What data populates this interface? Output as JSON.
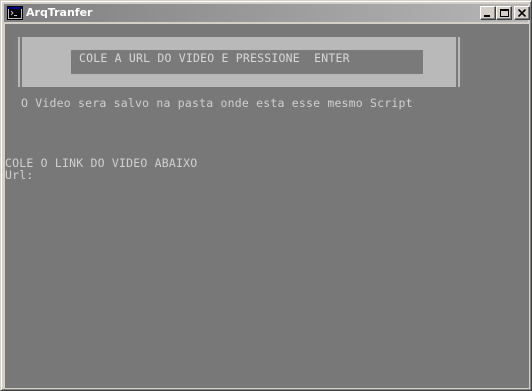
{
  "window": {
    "title": "ArqTranfer",
    "icon": "console-app-icon",
    "controls": {
      "minimize": "minimize-icon",
      "maximize": "maximize-icon",
      "close": "close-icon"
    }
  },
  "console": {
    "banner_text": "COLE A URL DO VIDEO E PRESSIONE  ENTER",
    "info_text": "O Video sera salvo na pasta onde esta esse mesmo Script",
    "prompt_title": "COLE O LINK DO VIDEO ABAIXO",
    "url_label": "Url:"
  },
  "colors": {
    "console_background": "#787878",
    "console_text": "#d0d0d0",
    "banner_background": "#b9b9b9"
  }
}
